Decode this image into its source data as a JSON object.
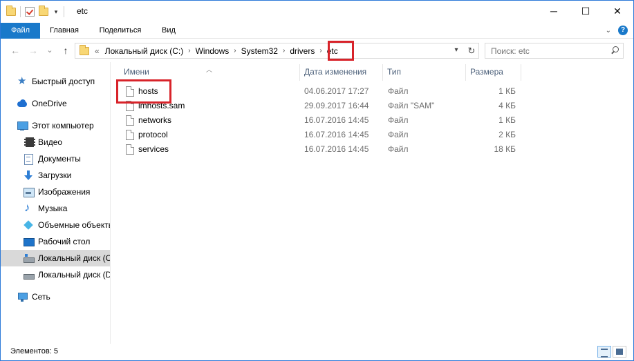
{
  "window": {
    "title": "etc",
    "minimize": "─",
    "maximize": "☐",
    "close": "✕"
  },
  "ribbon": {
    "tabs": [
      "Файл",
      "Главная",
      "Поделиться",
      "Вид"
    ]
  },
  "nav": {
    "back": "←",
    "forward": "→",
    "recent": "⌄",
    "up": "↑",
    "overflow": "«",
    "breadcrumbs": [
      "Локальный диск (C:)",
      "Windows",
      "System32",
      "drivers",
      "etc"
    ],
    "refresh": "↻",
    "dropdown": "▾"
  },
  "search": {
    "placeholder": "Поиск: etc"
  },
  "sidebar": {
    "items": [
      {
        "label": "Быстрый доступ",
        "icon": "star-icon"
      },
      {
        "label": "OneDrive",
        "icon": "cloud-icon"
      },
      {
        "label": "Этот компьютер",
        "icon": "computer-icon"
      },
      {
        "label": "Видео",
        "icon": "video-icon"
      },
      {
        "label": "Документы",
        "icon": "documents-icon"
      },
      {
        "label": "Загрузки",
        "icon": "downloads-icon"
      },
      {
        "label": "Изображения",
        "icon": "pictures-icon"
      },
      {
        "label": "Музыка",
        "icon": "music-icon"
      },
      {
        "label": "Объемные объекты",
        "icon": "3d-objects-icon"
      },
      {
        "label": "Рабочий стол",
        "icon": "desktop-icon"
      },
      {
        "label": "Локальный диск (C:)",
        "icon": "drive-c-icon"
      },
      {
        "label": "Локальный диск (D:)",
        "icon": "drive-d-icon"
      },
      {
        "label": "Сеть",
        "icon": "network-icon"
      }
    ]
  },
  "columns": {
    "name": "Имени",
    "date": "Дата изменения",
    "type": "Тип",
    "size": "Размера"
  },
  "files": [
    {
      "name": "hosts",
      "date": "04.06.2017 17:27",
      "type": "Файл",
      "size": "1 КБ"
    },
    {
      "name": "lmhosts.sam",
      "date": "29.09.2017 16:44",
      "type": "Файл \"SAM\"",
      "size": "4 КБ"
    },
    {
      "name": "networks",
      "date": "16.07.2016 14:45",
      "type": "Файл",
      "size": "1 КБ"
    },
    {
      "name": "protocol",
      "date": "16.07.2016 14:45",
      "type": "Файл",
      "size": "2 КБ"
    },
    {
      "name": "services",
      "date": "16.07.2016 14:45",
      "type": "Файл",
      "size": "18 КБ"
    }
  ],
  "status": {
    "items_count": "Элементов: 5"
  },
  "colors": {
    "accent": "#1979ca",
    "highlight": "#d8232a",
    "selected": "#d9d9d9"
  }
}
